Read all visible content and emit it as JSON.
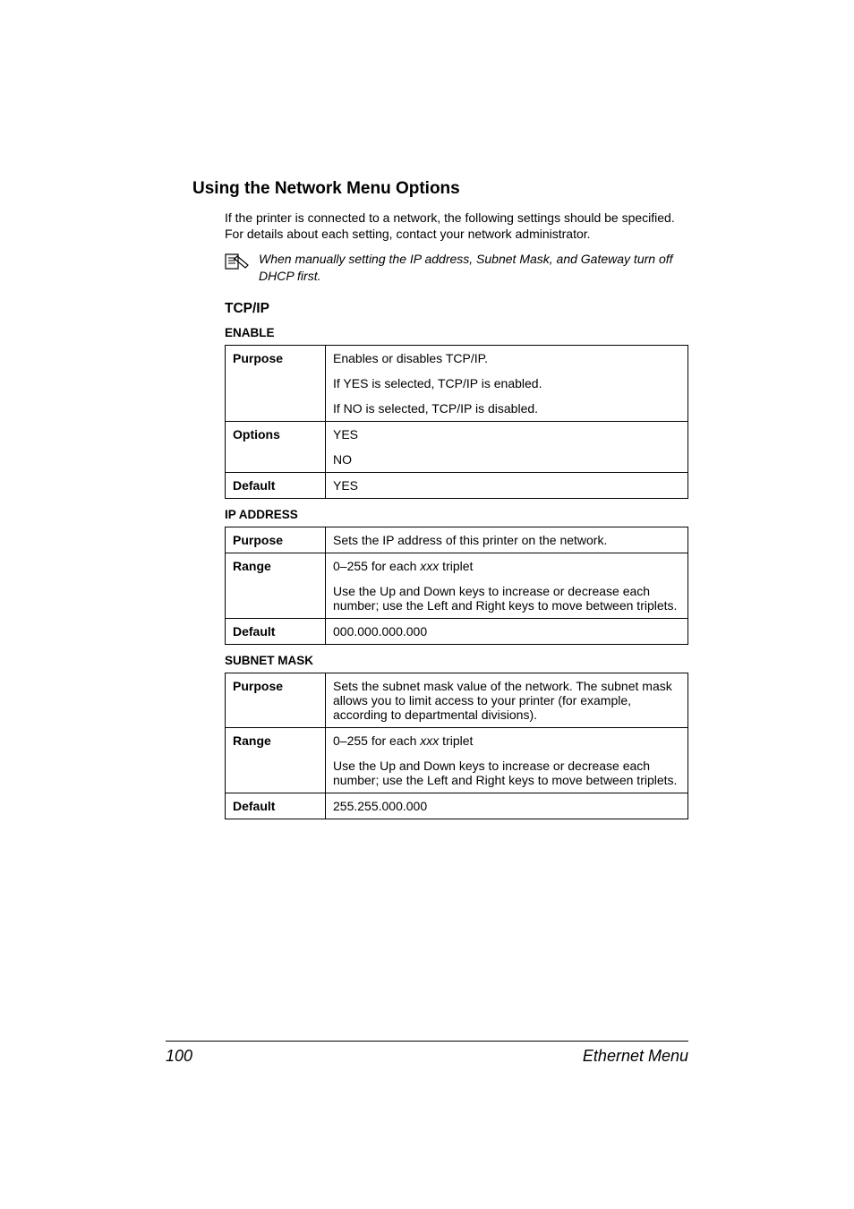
{
  "heading": "Using the Network Menu Options",
  "intro": "If the printer is connected to a network, the following settings should be specified. For details about each setting, contact your network administrator.",
  "note": "When manually setting the IP address, Subnet Mask, and Gateway turn off DHCP first.",
  "tcpip": {
    "title": "TCP/IP",
    "enable": {
      "label": "ENABLE",
      "cols": {
        "purpose": "Purpose",
        "options": "Options",
        "default": "Default"
      },
      "purpose_l1": "Enables or disables TCP/IP.",
      "purpose_l2": "If YES is selected, TCP/IP is enabled.",
      "purpose_l3": "If NO is selected, TCP/IP is disabled.",
      "opt1": "YES",
      "opt2": "NO",
      "def": "YES"
    },
    "ip": {
      "label": "IP ADDRESS",
      "cols": {
        "purpose": "Purpose",
        "range": "Range",
        "default": "Default"
      },
      "purpose": "Sets the IP address of this printer on the network.",
      "range_l1_pre": "0–255 for each ",
      "range_l1_em": "xxx",
      "range_l1_post": " triplet",
      "range_l2": "Use the Up and Down keys to increase or decrease each number; use the Left and Right keys to move between triplets.",
      "def": "000.000.000.000"
    },
    "subnet": {
      "label": "SUBNET MASK",
      "cols": {
        "purpose": "Purpose",
        "range": "Range",
        "default": "Default"
      },
      "purpose": "Sets the subnet mask value of the network. The subnet mask allows you to limit access to your printer (for example, according to departmental divisions).",
      "range_l1_pre": "0–255 for each ",
      "range_l1_em": "xxx",
      "range_l1_post": " triplet",
      "range_l2": "Use the Up and Down keys to increase or decrease each number; use the Left and Right keys to move between triplets.",
      "def": "255.255.000.000"
    }
  },
  "footer": {
    "page": "100",
    "title": "Ethernet Menu"
  }
}
